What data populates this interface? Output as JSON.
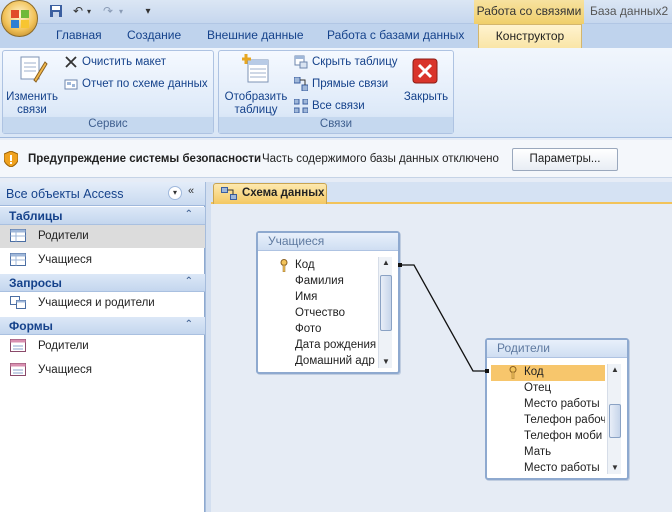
{
  "window": {
    "context_tab": "Работа со связями",
    "title": "База данных2"
  },
  "tabs": {
    "home": "Главная",
    "create": "Создание",
    "external": "Внешние данные",
    "dbtools": "Работа с базами данных",
    "designer": "Конструктор"
  },
  "ribbon": {
    "servis": {
      "label": "Сервис",
      "edit_relations": [
        "Изменить",
        "связи"
      ],
      "clear_layout": "Очистить макет",
      "report": "Отчет по схеме данных"
    },
    "svyazi": {
      "label": "Связи",
      "show_table": [
        "Отобразить",
        "таблицу"
      ],
      "hide_table": "Скрыть таблицу",
      "direct_links": "Прямые связи",
      "all_links": "Все связи",
      "close": "Закрыть"
    }
  },
  "security": {
    "title": "Предупреждение системы безопасности",
    "message": "Часть содержимого базы данных отключено",
    "button": "Параметры..."
  },
  "nav": {
    "header": "Все объекты Access",
    "sections": {
      "tables": {
        "title": "Таблицы",
        "items": [
          "Родители",
          "Учащиеся"
        ]
      },
      "queries": {
        "title": "Запросы",
        "items": [
          "Учащиеся и родители"
        ]
      },
      "forms": {
        "title": "Формы",
        "items": [
          "Родители",
          "Учащиеся"
        ]
      }
    }
  },
  "document": {
    "tab": "Схема данных",
    "tables": {
      "students": {
        "title": "Учащиеся",
        "fields": [
          "Код",
          "Фамилия",
          "Имя",
          "Отчество",
          "Фото",
          "Дата рождения",
          "Домашний адр"
        ]
      },
      "parents": {
        "title": "Родители",
        "fields": [
          "Код",
          "Отец",
          "Место работы",
          "Телефон рабоч",
          "Телефон моби",
          "Мать",
          "Место работы"
        ]
      }
    }
  },
  "colors": {
    "ribbon_bg": "#dbe6f4",
    "accent": "#f2c35a",
    "text": "#15428b",
    "selection": "#f7c66c"
  }
}
